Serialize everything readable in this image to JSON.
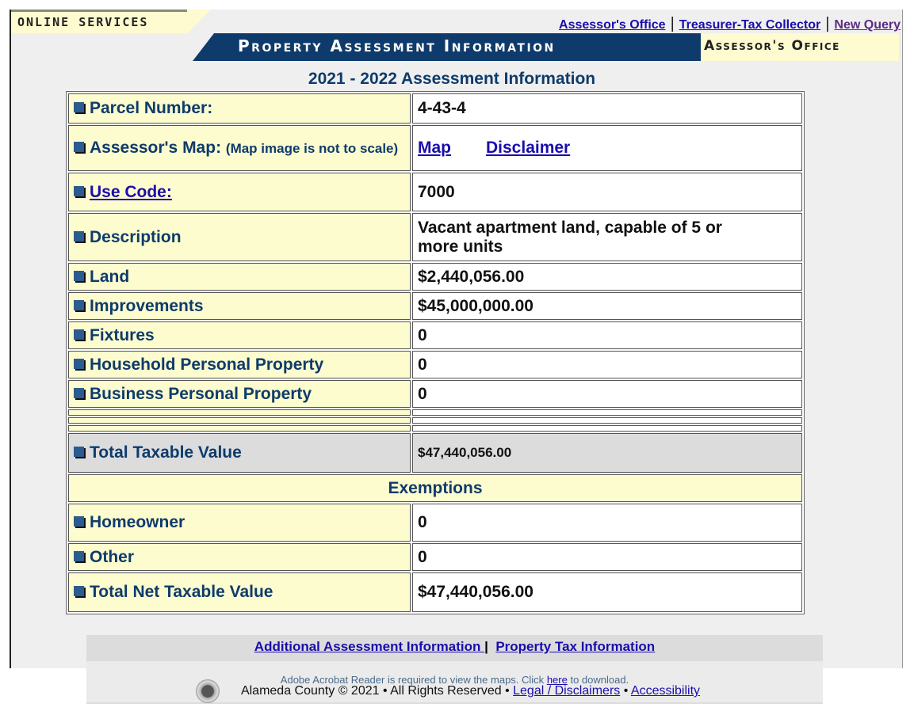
{
  "header": {
    "online_services": "ONLINE SERVICES",
    "banner_title": "Property Assessment Information",
    "banner_right": "Assessor's Office",
    "links": [
      "Assessor's Office",
      "Treasurer-Tax Collector",
      "New Query"
    ]
  },
  "title": "2021 - 2022 Assessment Information",
  "rows": {
    "parcel": {
      "label": "Parcel Number:",
      "value": "4-43-4"
    },
    "map": {
      "label": "Assessor's Map:",
      "note": "(Map image is not to scale)",
      "link1": "Map",
      "link2": "Disclaimer"
    },
    "use_code": {
      "label": "Use Code:",
      "value": "7000"
    },
    "description": {
      "label": "Description",
      "value": "Vacant apartment land, capable of 5 or more units"
    },
    "land": {
      "label": "Land",
      "value": "$2,440,056.00"
    },
    "improvements": {
      "label": "Improvements",
      "value": "$45,000,000.00"
    },
    "fixtures": {
      "label": "Fixtures",
      "value": "0"
    },
    "household": {
      "label": "Household Personal Property",
      "value": "0"
    },
    "business": {
      "label": "Business Personal Property",
      "value": "0"
    },
    "total_taxable": {
      "label": "Total Taxable Value",
      "value": "$47,440,056.00"
    },
    "exemptions_header": "Exemptions",
    "homeowner": {
      "label": "Homeowner",
      "value": "0"
    },
    "other": {
      "label": "Other",
      "value": "0"
    },
    "total_net": {
      "label": "Total Net Taxable Value",
      "value": "$47,440,056.00"
    }
  },
  "footer": {
    "additional_link": "Additional Assessment Information ",
    "separator": "|",
    "tax_link": "Property Tax Information",
    "acrobat_pre": "Adobe Acrobat Reader is required to view the maps.   Click ",
    "acrobat_link": "here",
    "acrobat_post": " to download.",
    "copyright": "Alameda County © 2021 • All Rights Reserved • ",
    "legal_link": "Legal / Disclaimers",
    "bullet": " • ",
    "accessibility_link": "Accessibility"
  }
}
